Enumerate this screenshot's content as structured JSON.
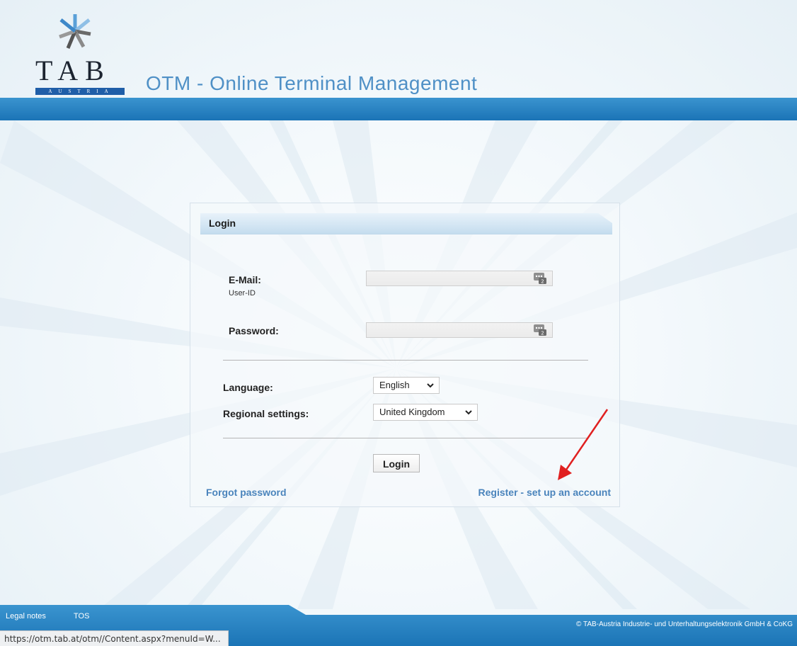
{
  "header": {
    "logo_letters": "TAB",
    "logo_sub": "AUSTRIA",
    "app_title": "OTM - Online Terminal Management"
  },
  "login_panel": {
    "title": "Login",
    "email_label": "E-Mail:",
    "email_sublabel": "User-ID",
    "email_value": "",
    "password_label": "Password:",
    "password_value": "",
    "language_label": "Language:",
    "language_selected": "English",
    "regional_label": "Regional settings:",
    "regional_selected": "United Kingdom",
    "login_button": "Login",
    "forgot_password_link": "Forgot password",
    "register_link": "Register - set up an account"
  },
  "footer": {
    "legal_notes": "Legal notes",
    "tos": "TOS",
    "copyright": "© TAB-Austria Industrie- und Unterhaltungselektronik GmbH & CoKG"
  },
  "status_bar": {
    "url": "https://otm.tab.at/otm//Content.aspx?menuId=W..."
  },
  "colors": {
    "brand_blue": "#1b74b6",
    "title_blue": "#4f90c6",
    "link_blue": "#4a84bc",
    "annotation_arrow": "#e02020"
  },
  "icons": {
    "logo_mark": "star-burst-icon",
    "field_key": "password-key-icon",
    "dropdown": "chevron-down-icon",
    "annotation": "red-arrow-icon"
  }
}
